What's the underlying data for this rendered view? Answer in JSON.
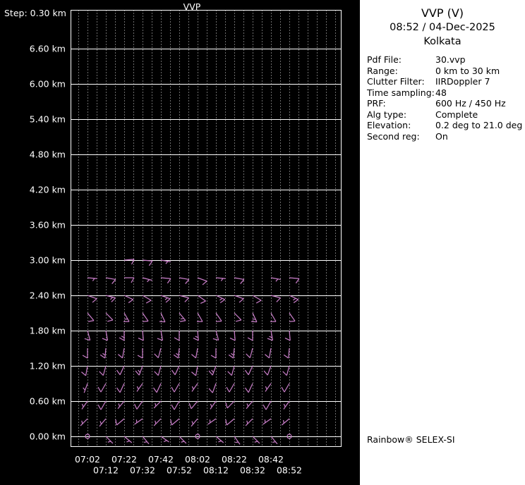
{
  "chart_data": {
    "type": "wind-barb-time-height",
    "title": "VVP",
    "step_label": "Step: 0.30 km",
    "x_tick_labels": [
      "07:02",
      "07:12",
      "07:22",
      "07:32",
      "07:42",
      "07:52",
      "08:02",
      "08:12",
      "08:22",
      "08:32",
      "08:42",
      "08:52"
    ],
    "y_tick_labels": [
      "6.60 km",
      "6.00 km",
      "5.40 km",
      "4.80 km",
      "4.20 km",
      "3.60 km",
      "3.00 km",
      "2.40 km",
      "1.80 km",
      "1.20 km",
      "0.60 km",
      "0.00 km"
    ],
    "y_levels_km": [
      6.6,
      6.0,
      5.4,
      4.8,
      4.2,
      3.6,
      3.0,
      2.4,
      1.8,
      1.2,
      0.6,
      0.0
    ],
    "height_step_km": 0.3,
    "x_range": [
      "07:02",
      "08:52"
    ],
    "y_range_km": [
      0.0,
      7.2
    ],
    "grid": "solid horizontal lines every 0.60 km, dotted vertical time lines",
    "background": "#000000",
    "grid_color": "#ffffff",
    "barb_color": "#cc80cc",
    "barbs_format": "[time_index, height_km, wind_from_deg, speed_kt]; speed 0 = calm circle",
    "barbs": [
      [
        2,
        3.0,
        85,
        10
      ],
      [
        3,
        3.0,
        95,
        10
      ],
      [
        4,
        3.0,
        100,
        5
      ],
      [
        0,
        2.7,
        95,
        5
      ],
      [
        1,
        2.7,
        100,
        10
      ],
      [
        2,
        2.7,
        90,
        10
      ],
      [
        3,
        2.7,
        105,
        5
      ],
      [
        4,
        2.7,
        95,
        10
      ],
      [
        5,
        2.7,
        100,
        10
      ],
      [
        6,
        2.7,
        110,
        10
      ],
      [
        7,
        2.7,
        95,
        5
      ],
      [
        8,
        2.7,
        100,
        10
      ],
      [
        10,
        2.7,
        100,
        5
      ],
      [
        11,
        2.7,
        95,
        10
      ],
      [
        0,
        2.4,
        110,
        10
      ],
      [
        1,
        2.4,
        105,
        15
      ],
      [
        2,
        2.4,
        115,
        10
      ],
      [
        3,
        2.4,
        120,
        10
      ],
      [
        4,
        2.4,
        110,
        15
      ],
      [
        5,
        2.4,
        105,
        10
      ],
      [
        6,
        2.4,
        125,
        10
      ],
      [
        7,
        2.4,
        115,
        15
      ],
      [
        8,
        2.4,
        110,
        10
      ],
      [
        9,
        2.4,
        120,
        10
      ],
      [
        10,
        2.4,
        105,
        10
      ],
      [
        11,
        2.4,
        115,
        15
      ],
      [
        0,
        2.1,
        140,
        10
      ],
      [
        1,
        2.1,
        135,
        10
      ],
      [
        2,
        2.1,
        150,
        15
      ],
      [
        3,
        2.1,
        145,
        10
      ],
      [
        4,
        2.1,
        155,
        10
      ],
      [
        5,
        2.1,
        140,
        15
      ],
      [
        6,
        2.1,
        150,
        10
      ],
      [
        7,
        2.1,
        145,
        10
      ],
      [
        8,
        2.1,
        135,
        10
      ],
      [
        9,
        2.1,
        155,
        15
      ],
      [
        10,
        2.1,
        150,
        10
      ],
      [
        11,
        2.1,
        145,
        10
      ],
      [
        0,
        1.8,
        165,
        10
      ],
      [
        1,
        1.8,
        170,
        10
      ],
      [
        2,
        1.8,
        180,
        15
      ],
      [
        3,
        1.8,
        175,
        10
      ],
      [
        4,
        1.8,
        170,
        10
      ],
      [
        5,
        1.8,
        180,
        10
      ],
      [
        6,
        1.8,
        175,
        15
      ],
      [
        7,
        1.8,
        165,
        10
      ],
      [
        8,
        1.8,
        175,
        10
      ],
      [
        9,
        1.8,
        180,
        10
      ],
      [
        10,
        1.8,
        170,
        15
      ],
      [
        11,
        1.8,
        175,
        10
      ],
      [
        0,
        1.5,
        180,
        10
      ],
      [
        1,
        1.5,
        185,
        15
      ],
      [
        2,
        1.5,
        190,
        10
      ],
      [
        3,
        1.5,
        180,
        10
      ],
      [
        4,
        1.5,
        195,
        10
      ],
      [
        5,
        1.5,
        185,
        15
      ],
      [
        6,
        1.5,
        190,
        10
      ],
      [
        7,
        1.5,
        180,
        10
      ],
      [
        8,
        1.5,
        185,
        15
      ],
      [
        9,
        1.5,
        195,
        10
      ],
      [
        10,
        1.5,
        190,
        10
      ],
      [
        11,
        1.5,
        185,
        10
      ],
      [
        0,
        1.2,
        190,
        10
      ],
      [
        1,
        1.2,
        195,
        10
      ],
      [
        2,
        1.2,
        205,
        10
      ],
      [
        3,
        1.2,
        200,
        15
      ],
      [
        4,
        1.2,
        195,
        10
      ],
      [
        5,
        1.2,
        205,
        10
      ],
      [
        6,
        1.2,
        190,
        10
      ],
      [
        7,
        1.2,
        200,
        15
      ],
      [
        8,
        1.2,
        195,
        10
      ],
      [
        9,
        1.2,
        205,
        10
      ],
      [
        10,
        1.2,
        200,
        10
      ],
      [
        11,
        1.2,
        195,
        10
      ],
      [
        0,
        0.9,
        200,
        5
      ],
      [
        1,
        0.9,
        210,
        10
      ],
      [
        2,
        0.9,
        205,
        10
      ],
      [
        3,
        0.9,
        215,
        5
      ],
      [
        4,
        0.9,
        205,
        10
      ],
      [
        5,
        0.9,
        210,
        10
      ],
      [
        6,
        0.9,
        215,
        5
      ],
      [
        7,
        0.9,
        200,
        10
      ],
      [
        8,
        0.9,
        210,
        10
      ],
      [
        9,
        0.9,
        205,
        10
      ],
      [
        10,
        0.9,
        215,
        5
      ],
      [
        11,
        0.9,
        210,
        10
      ],
      [
        0,
        0.6,
        215,
        5
      ],
      [
        1,
        0.6,
        210,
        10
      ],
      [
        2,
        0.6,
        220,
        5
      ],
      [
        3,
        0.6,
        215,
        10
      ],
      [
        4,
        0.6,
        225,
        5
      ],
      [
        5,
        0.6,
        210,
        10
      ],
      [
        6,
        0.6,
        220,
        10
      ],
      [
        7,
        0.6,
        215,
        5
      ],
      [
        8,
        0.6,
        225,
        10
      ],
      [
        9,
        0.6,
        220,
        5
      ],
      [
        10,
        0.6,
        210,
        10
      ],
      [
        11,
        0.6,
        215,
        5
      ],
      [
        0,
        0.3,
        225,
        5
      ],
      [
        1,
        0.3,
        220,
        5
      ],
      [
        2,
        0.3,
        230,
        10
      ],
      [
        3,
        0.3,
        235,
        5
      ],
      [
        4,
        0.3,
        225,
        5
      ],
      [
        5,
        0.3,
        230,
        10
      ],
      [
        6,
        0.3,
        220,
        5
      ],
      [
        7,
        0.3,
        235,
        5
      ],
      [
        8,
        0.3,
        230,
        10
      ],
      [
        9,
        0.3,
        225,
        5
      ],
      [
        10,
        0.3,
        235,
        5
      ],
      [
        11,
        0.3,
        230,
        5
      ],
      [
        0,
        0.0,
        0,
        0
      ],
      [
        1,
        0.0,
        135,
        5
      ],
      [
        2,
        0.0,
        130,
        5
      ],
      [
        3,
        0.0,
        140,
        5
      ],
      [
        4,
        0.0,
        125,
        5
      ],
      [
        5,
        0.0,
        135,
        5
      ],
      [
        6,
        0.0,
        0,
        0
      ],
      [
        7,
        0.0,
        130,
        5
      ],
      [
        8,
        0.0,
        145,
        5
      ],
      [
        9,
        0.0,
        135,
        5
      ],
      [
        10,
        0.0,
        140,
        5
      ],
      [
        11,
        0.0,
        0,
        0
      ]
    ]
  },
  "info": {
    "title": "VVP (V)",
    "datetime": "08:52 / 04-Dec-2025",
    "site": "Kolkata",
    "fields": [
      {
        "label": "Pdf File:",
        "value": "30.vvp"
      },
      {
        "label": "Range:",
        "value": "0 km to 30 km"
      },
      {
        "label": "Clutter Filter:",
        "value": "IIRDoppler 7"
      },
      {
        "label": "Time sampling:",
        "value": "48"
      },
      {
        "label": "PRF:",
        "value": "600 Hz / 450 Hz"
      },
      {
        "label": "Alg type:",
        "value": "Complete"
      },
      {
        "label": "Elevation:",
        "value": "0.2 deg to 21.0 deg"
      },
      {
        "label": "Second reg:",
        "value": "On"
      }
    ],
    "footer": "Rainbow® SELEX-SI"
  }
}
